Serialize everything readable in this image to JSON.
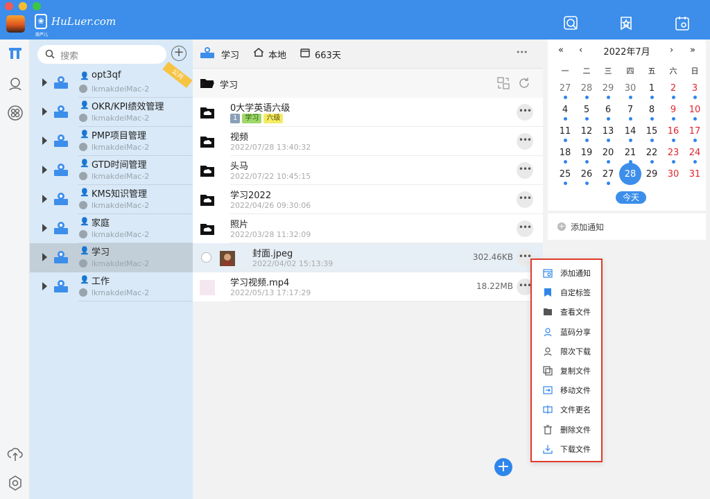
{
  "app": {
    "logo_text": "HuLuer.com",
    "logo_sub": "葫芦儿"
  },
  "window_controls": [
    "close",
    "minimize",
    "zoom"
  ],
  "titlebar_icons": [
    "search-icon",
    "tag-icon",
    "calendar-icon"
  ],
  "rail_icons": [
    "app-home-icon",
    "person-icon",
    "grid-icon",
    "cloud-upload-icon",
    "settings-icon"
  ],
  "sidebar": {
    "search_placeholder": "搜索",
    "ribbon": "公共",
    "libraries": [
      {
        "name": "opt3qf",
        "host": "lkmakdeiMac-2"
      },
      {
        "name": "OKR/KPI绩效管理",
        "host": "lkmakdeiMac-2"
      },
      {
        "name": "PMP项目管理",
        "host": "lkmakdeiMac-2"
      },
      {
        "name": "GTD时间管理",
        "host": "lkmakdeiMac-2"
      },
      {
        "name": "KMS知识管理",
        "host": "lkmakdeiMac-2"
      },
      {
        "name": "家庭",
        "host": "lkmakdeiMac-2"
      },
      {
        "name": "学习",
        "host": "lkmakdeiMac-2"
      },
      {
        "name": "工作",
        "host": "lkmakdeiMac-2"
      }
    ]
  },
  "main": {
    "header": {
      "library": "学习",
      "location": "本地",
      "days": "663天",
      "more": "•••"
    },
    "folder_title": "学习",
    "files": [
      {
        "name": "0大学英语六级",
        "tags": [
          "1",
          "学习",
          "六级"
        ],
        "date": "",
        "size": ""
      },
      {
        "name": "视频",
        "date": "2022/07/28 13:40:32",
        "size": ""
      },
      {
        "name": "头马",
        "date": "2022/07/22 10:45:15",
        "size": ""
      },
      {
        "name": "学习2022",
        "date": "2022/04/26 09:30:06",
        "size": ""
      },
      {
        "name": "照片",
        "date": "2022/03/28 11:32:09",
        "size": ""
      },
      {
        "name": "封面.jpeg",
        "date": "2022/04/02 15:13:39",
        "size": "302.46KB"
      },
      {
        "name": "学习视频.mp4",
        "date": "2022/05/13 17:17:29",
        "size": "18.22MB"
      }
    ],
    "more_label": "•••",
    "fab": "+"
  },
  "calendar": {
    "title": "2022年7月",
    "nav": {
      "prev_year": "«",
      "prev_month": "‹",
      "next_month": "›",
      "next_year": "»"
    },
    "weekdays": [
      "一",
      "二",
      "三",
      "四",
      "五",
      "六",
      "日"
    ],
    "weeks": [
      [
        "27",
        "28",
        "29",
        "30",
        "1",
        "2",
        "3"
      ],
      [
        "4",
        "5",
        "6",
        "7",
        "8",
        "9",
        "10"
      ],
      [
        "11",
        "12",
        "13",
        "14",
        "15",
        "16",
        "17"
      ],
      [
        "18",
        "19",
        "20",
        "21",
        "22",
        "23",
        "24"
      ],
      [
        "25",
        "26",
        "27",
        "28",
        "29",
        "30",
        "31"
      ]
    ],
    "today": "28",
    "today_button": "今天",
    "accent": "#3c8eea",
    "weekend_color": "#e0252b"
  },
  "notify": {
    "add_label": "添加通知"
  },
  "context_menu": {
    "items": [
      {
        "label": "添加通知",
        "icon": "calendar-add-icon"
      },
      {
        "label": "自定标签",
        "icon": "tag-icon"
      },
      {
        "label": "查看文件",
        "icon": "folder-open-icon"
      },
      {
        "label": "蓝码分享",
        "icon": "share-user-icon"
      },
      {
        "label": "限次下载",
        "icon": "limited-download-icon"
      },
      {
        "label": "复制文件",
        "icon": "copy-icon"
      },
      {
        "label": "移动文件",
        "icon": "move-icon"
      },
      {
        "label": "文件更名",
        "icon": "rename-icon"
      },
      {
        "label": "删除文件",
        "icon": "trash-icon"
      },
      {
        "label": "下载文件",
        "icon": "download-icon"
      }
    ]
  }
}
